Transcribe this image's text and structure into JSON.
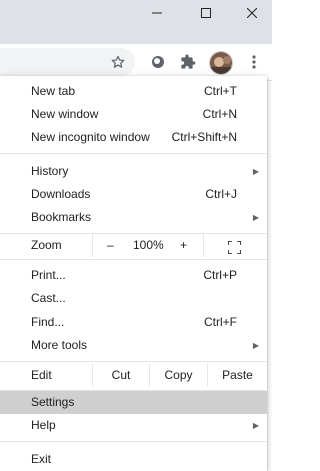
{
  "window_controls": {
    "minimize_icon": "minimize-icon",
    "maximize_icon": "maximize-icon",
    "close_icon": "close-icon"
  },
  "toolbar": {
    "icons": [
      "star-icon",
      "extension-circle-icon",
      "puzzle-icon",
      "avatar",
      "kebab-menu-icon"
    ]
  },
  "menu": {
    "group1": [
      {
        "label": "New tab",
        "shortcut": "Ctrl+T"
      },
      {
        "label": "New window",
        "shortcut": "Ctrl+N"
      },
      {
        "label": "New incognito window",
        "shortcut": "Ctrl+Shift+N"
      }
    ],
    "group2": [
      {
        "label": "History",
        "shortcut": ""
      },
      {
        "label": "Downloads",
        "shortcut": "Ctrl+J"
      },
      {
        "label": "Bookmarks",
        "shortcut": ""
      }
    ],
    "zoom": {
      "label": "Zoom",
      "minus": "–",
      "value": "100%",
      "plus": "+"
    },
    "group3": [
      {
        "label": "Print...",
        "shortcut": "Ctrl+P"
      },
      {
        "label": "Cast...",
        "shortcut": ""
      },
      {
        "label": "Find...",
        "shortcut": "Ctrl+F"
      },
      {
        "label": "More tools",
        "shortcut": ""
      }
    ],
    "edit": {
      "label": "Edit",
      "cut": "Cut",
      "copy": "Copy",
      "paste": "Paste"
    },
    "group4": [
      {
        "label": "Settings",
        "shortcut": ""
      },
      {
        "label": "Help",
        "shortcut": ""
      }
    ],
    "exit": {
      "label": "Exit"
    }
  },
  "colors": {
    "titlebar": "#dee1e6",
    "highlight": "#cfcfcf",
    "text": "#202124"
  }
}
